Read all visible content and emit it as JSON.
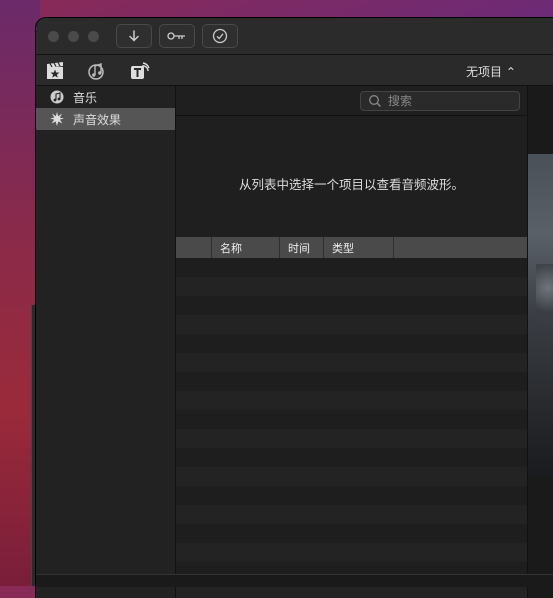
{
  "toolbar": {
    "import_button_icon": "down-arrow-icon",
    "keyword_button_icon": "key-icon",
    "check_button_icon": "checkmark-circle-icon"
  },
  "browser_tabs": [
    {
      "name": "photos-and-audio",
      "icon": "clapper-star-icon"
    },
    {
      "name": "music-sound",
      "icon": "music-note-icon"
    },
    {
      "name": "titles-generators",
      "icon": "title-t-icon"
    }
  ],
  "project": {
    "label": "无项目 ⌃"
  },
  "sidebar": {
    "items": [
      {
        "label": "音乐",
        "icon": "music-icon",
        "selected": false
      },
      {
        "label": "声音效果",
        "icon": "burst-icon",
        "selected": true
      }
    ]
  },
  "search": {
    "placeholder": "搜索"
  },
  "main": {
    "message": "从列表中选择一个项目以查看音频波形。"
  },
  "table": {
    "columns": [
      "名称",
      "时间",
      "类型"
    ],
    "rows": []
  }
}
